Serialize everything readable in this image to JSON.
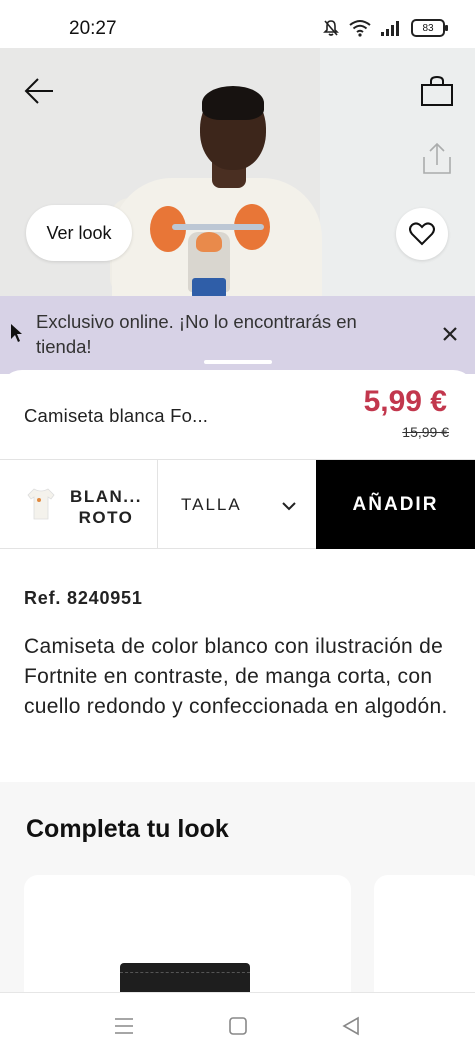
{
  "status_bar": {
    "time": "20:27",
    "battery": "83",
    "icons": [
      "mute-icon",
      "wifi-icon",
      "signal-icon",
      "battery-icon"
    ]
  },
  "header": {
    "icons": [
      "back-arrow-icon",
      "shopping-bag-icon",
      "share-icon",
      "heart-icon"
    ],
    "ver_look_label": "Ver look"
  },
  "banner": {
    "text": "Exclusivo online. ¡No lo encontrarás en tienda!"
  },
  "product": {
    "name": "Camiseta blanca Fo...",
    "price": "5,99 €",
    "old_price": "15,99 €",
    "price_color": "#c2374d"
  },
  "actions": {
    "color_label": "BLAN... ROTO",
    "size_label": "TALLA",
    "add_label": "AÑADIR"
  },
  "details": {
    "ref": "Ref. 8240951",
    "description": "Camiseta de color blanco con ilustración de Fortnite en contraste, de manga corta, con cuello redondo y confeccionada en algodón."
  },
  "look": {
    "title": "Completa tu look"
  },
  "nav": {
    "icons": [
      "menu-icon",
      "home-icon",
      "back-icon"
    ]
  }
}
